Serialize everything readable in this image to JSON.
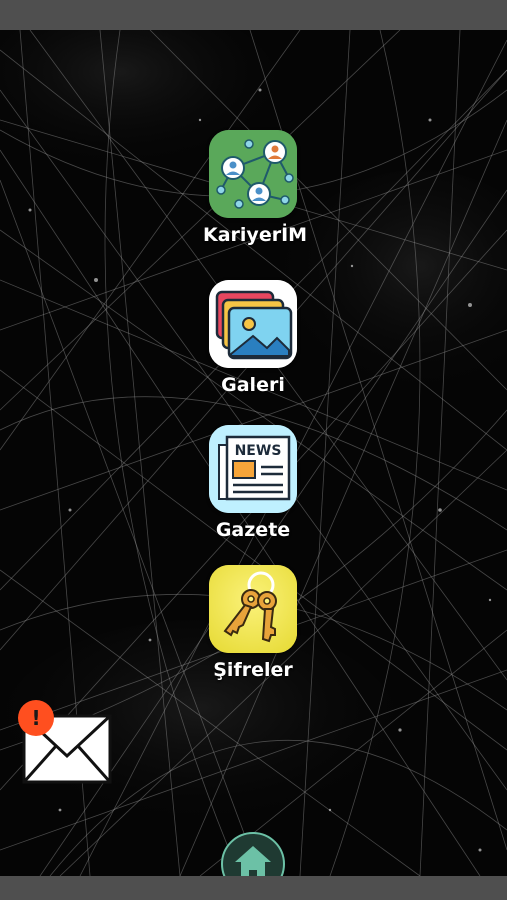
{
  "apps": [
    {
      "label": "KariyerİM",
      "icon": "network-people-icon"
    },
    {
      "label": "Galeri",
      "icon": "gallery-photos-icon"
    },
    {
      "label": "Gazete",
      "icon": "newspaper-icon"
    },
    {
      "label": "Şifreler",
      "icon": "keys-icon"
    }
  ],
  "icons": {
    "mail": "mail-envelope-icon",
    "alert": "alert-badge-icon",
    "home": "home-icon"
  },
  "newspaper_title": "NEWS",
  "alert_symbol": "!",
  "colors": {
    "background": "#050505",
    "status_bar": "#4f4f4f",
    "kariyer_bg": "#5aa85a",
    "galeri_bg": "#ffffff",
    "gazete_bg": "#bff0ff",
    "sifreler_bg": "#f3ea5a",
    "alert": "#ff4f1f",
    "home_accent": "#6cc1a6"
  }
}
